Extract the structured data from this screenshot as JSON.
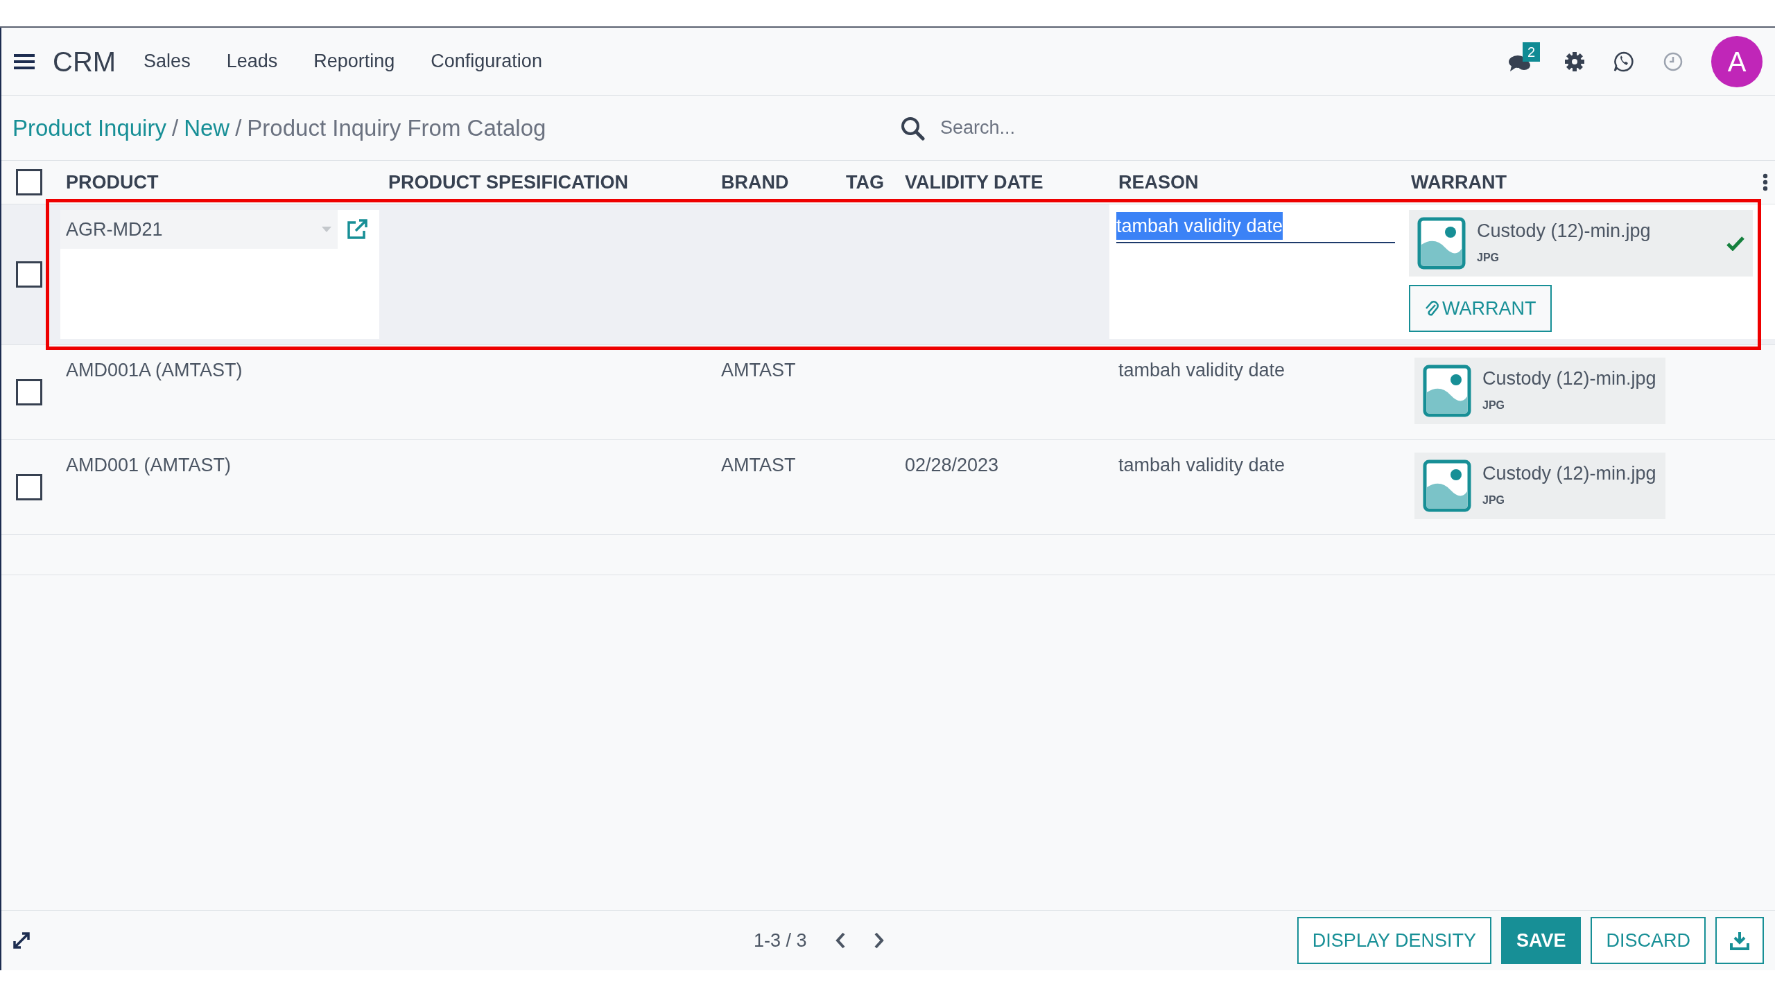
{
  "navbar": {
    "brand": "CRM",
    "menu": [
      {
        "label": "Sales"
      },
      {
        "label": "Leads"
      },
      {
        "label": "Reporting"
      },
      {
        "label": "Configuration"
      }
    ],
    "message_count": "2",
    "avatar": "A"
  },
  "breadcrumb": [
    {
      "label": "Product Inquiry",
      "kind": "link"
    },
    {
      "label": "/",
      "kind": "separator"
    },
    {
      "label": "New",
      "kind": "link"
    },
    {
      "label": "/",
      "kind": "separator"
    },
    {
      "label": "Product Inquiry From Catalog",
      "kind": "current"
    }
  ],
  "search": {
    "placeholder": "Search..."
  },
  "table": {
    "all_checked": false,
    "columns": [
      "PRODUCT",
      "PRODUCT SPESIFICATION",
      "BRAND",
      "TAG",
      "VALIDITY DATE",
      "REASON",
      "WARRANT"
    ],
    "rows": [
      {
        "checked": false,
        "editing": true,
        "highlighted": true,
        "product": "AGR-MD21",
        "brand": "",
        "tag": "",
        "validity_date": "",
        "reason": "tambah validity date",
        "warrant": {
          "file_name": "Custody (12)-min.jpg",
          "file_type": "JPG",
          "uploaded": true
        },
        "attach_button": "WARRANT"
      },
      {
        "checked": false,
        "editing": false,
        "highlighted": false,
        "product": "AMD001A (AMTAST)",
        "brand": "AMTAST",
        "tag": "",
        "validity_date": "",
        "reason": "tambah validity date",
        "warrant": {
          "file_name": "Custody (12)-min.jpg",
          "file_type": "JPG",
          "uploaded": false
        }
      },
      {
        "checked": false,
        "editing": false,
        "highlighted": false,
        "product": "AMD001 (AMTAST)",
        "brand": "AMTAST",
        "tag": "",
        "validity_date": "02/28/2023",
        "reason": "tambah validity date",
        "warrant": {
          "file_name": "Custody (12)-min.jpg",
          "file_type": "JPG",
          "uploaded": false
        }
      }
    ]
  },
  "footer": {
    "pager": "1-3 / 3",
    "buttons": [
      {
        "label": "DISPLAY DENSITY",
        "kind": "outline"
      },
      {
        "label": "SAVE",
        "kind": "primary"
      },
      {
        "label": "DISCARD",
        "kind": "outline"
      }
    ]
  }
}
